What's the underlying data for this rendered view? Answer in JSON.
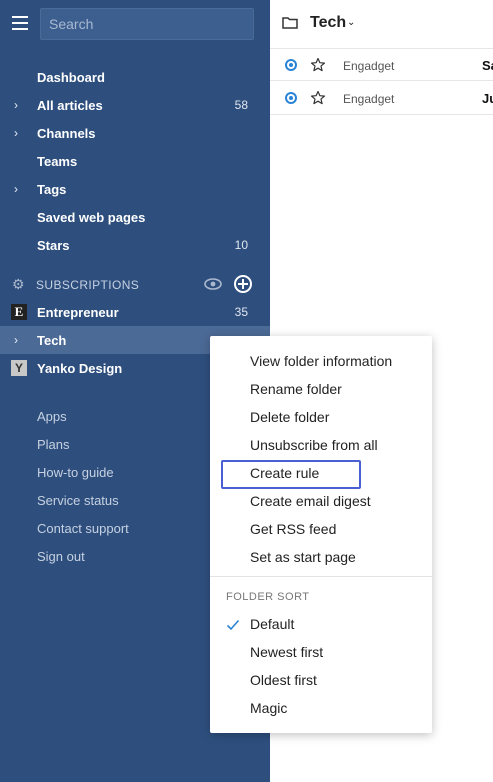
{
  "search": {
    "placeholder": "Search"
  },
  "nav": [
    {
      "label": "Dashboard",
      "count": "",
      "chevron": false
    },
    {
      "label": "All articles",
      "count": "58",
      "chevron": true
    },
    {
      "label": "Channels",
      "count": "",
      "chevron": true
    },
    {
      "label": "Teams",
      "count": "",
      "chevron": false
    },
    {
      "label": "Tags",
      "count": "",
      "chevron": true
    },
    {
      "label": "Saved web pages",
      "count": "",
      "chevron": false
    },
    {
      "label": "Stars",
      "count": "10",
      "chevron": false
    }
  ],
  "subscriptions": {
    "title": "SUBSCRIPTIONS",
    "feeds": [
      {
        "label": "Entrepreneur",
        "count": "35",
        "icon": "entrepreneur-icon",
        "icon_letter": "E"
      },
      {
        "label": "Tech",
        "count": "",
        "icon": "chevron-right-icon"
      },
      {
        "label": "Yanko Design",
        "count": "",
        "icon": "yanko-design-icon",
        "icon_letter": "Y"
      }
    ]
  },
  "footer": [
    "Apps",
    "Plans",
    "How-to guide",
    "Service status",
    "Contact support",
    "Sign out"
  ],
  "main": {
    "folder_title": "Tech",
    "articles": [
      {
        "source": "Engadget",
        "title_fragment": "Sa"
      },
      {
        "source": "Engadget",
        "title_fragment": "Ju"
      }
    ]
  },
  "menu": {
    "items": [
      "View folder information",
      "Rename folder",
      "Delete folder",
      "Unsubscribe from all",
      "Create rule",
      "Create email digest",
      "Get RSS feed",
      "Set as start page"
    ],
    "sort_section": "FOLDER SORT",
    "sort_options": [
      "Default",
      "Newest first",
      "Oldest first",
      "Magic"
    ],
    "selected_sort": "Default",
    "highlighted_item": "Create rule"
  },
  "colors": {
    "sidebar": "#2e4f7e",
    "active_row": "#4c6a96",
    "accent": "#2a84d6",
    "highlight": "#4a5fd4"
  }
}
